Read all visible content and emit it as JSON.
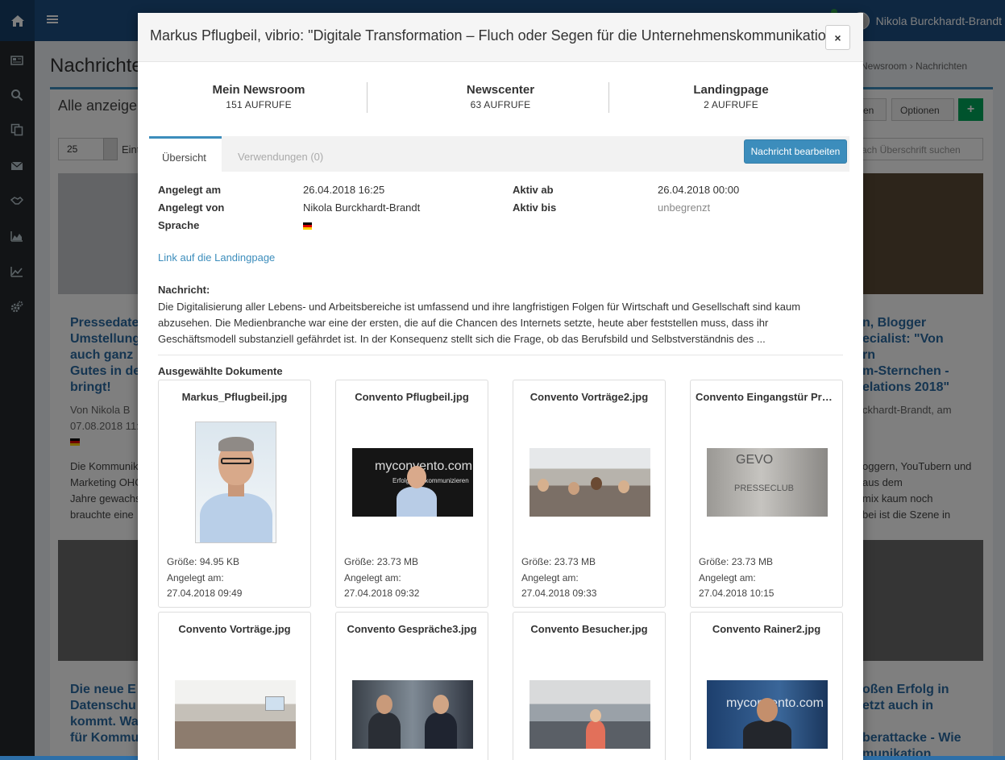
{
  "app": {
    "user_name": "Nikola Burckhardt-Brandt",
    "colors": {
      "topbar": "#1d4e82",
      "sidebar": "#24292d",
      "accent": "#3c8dbc",
      "success": "#00a65a"
    },
    "sidebar_icons": [
      "home-icon",
      "newspaper-icon",
      "search-icon",
      "copy-icon",
      "envelope-icon",
      "handshake-icon",
      "area-chart-icon",
      "line-chart-icon",
      "cogs-icon"
    ]
  },
  "background": {
    "page_title": "Nachrichten",
    "breadcrumb": {
      "newsroom": "Newsroom",
      "sep": "›",
      "current": "Nachrichten"
    },
    "panel_title": "Alle anzeigen",
    "page_size": "25",
    "page_size_suffix": "Eint",
    "buttons": {
      "partial": "en",
      "options": "Optionen"
    },
    "add_symbol": "+",
    "search_placeholder": "ach Überschrift suchen",
    "left_card": {
      "headline_lines": [
        "Pressedate",
        "Umstellung",
        "auch ganz",
        "Gutes in de",
        "bringt!"
      ],
      "meta_line1": "Von Nikola B",
      "meta_line2": "07.08.2018 11:",
      "text_lines": [
        "Die Kommunik",
        "Marketing OHC",
        "Jahre gewachs",
        "brauchte eine"
      ]
    },
    "right_card": {
      "headline_lines": [
        "n, Blogger",
        "ecialist: \"Von",
        "rn",
        "m-Sternchen -",
        "elations 2018\""
      ],
      "meta": "ckhardt-Brandt, am",
      "text_lines": [
        "oggern, YouTubern und",
        "aus dem",
        "mix kaum noch",
        "bei ist die Szene in"
      ]
    },
    "left_bottom": {
      "headline_lines": [
        "Die neue E",
        "Datenschu",
        "kommt. Wa",
        "für Kommu"
      ]
    },
    "right_bottom": {
      "headline_lines": [
        "oßen Erfolg in",
        "etzt auch in",
        "",
        "berattacke - Wie",
        "munikation"
      ]
    }
  },
  "modal": {
    "title": "Markus Pflugbeil, vibrio: \"Digitale Transformation – Fluch oder Segen für die Unternehmenskommunikation?\"",
    "close_label": "×",
    "stats": [
      {
        "label": "Mein Newsroom",
        "count": "151 AUFRUFE"
      },
      {
        "label": "Newscenter",
        "count": "63 AUFRUFE"
      },
      {
        "label": "Landingpage",
        "count": "2 AUFRUFE"
      }
    ],
    "tabs": [
      {
        "label": "Übersicht",
        "active": true
      },
      {
        "label": "Verwendungen (0)",
        "active": false
      }
    ],
    "edit_button": "Nachricht bearbeiten",
    "info": {
      "created_at_label": "Angelegt am",
      "created_at": "26.04.2018 16:25",
      "created_by_label": "Angelegt von",
      "created_by": "Nikola Burckhardt-Brandt",
      "language_label": "Sprache",
      "language_flag": "de-flag-icon",
      "active_from_label": "Aktiv ab",
      "active_from": "26.04.2018 00:00",
      "active_until_label": "Aktiv bis",
      "active_until": "unbegrenzt"
    },
    "landing_link": "Link auf die Landingpage",
    "message_label": "Nachricht:",
    "message_text": "Die Digitalisierung aller Lebens- und Arbeitsbereiche ist umfassend und ihre langfristigen Folgen für Wirtschaft und Gesellschaft sind kaum abzusehen. Die Medienbranche war eine der ersten, die auf die Chancen des Internets setzte, heute aber feststellen muss, dass ihr Geschäftsmodell substanziell gefährdet ist. In der Konsequenz stellt sich die Frage, ob das Berufsbild und Selbstverständnis des ...",
    "documents_label": "Ausgewählte Dokumente",
    "size_label": "Größe:",
    "created_label": "Angelegt am:",
    "documents": [
      {
        "name": "Markus_Pflugbeil.jpg",
        "size": "94.95 KB",
        "created": "27.04.2018 09:49",
        "thumb": "portrait"
      },
      {
        "name": "Convento Pflugbeil.jpg",
        "size": "23.73 MB",
        "created": "27.04.2018 09:32",
        "thumb": "mycom-dark"
      },
      {
        "name": "Convento Vorträge2.jpg",
        "size": "23.73 MB",
        "created": "27.04.2018 09:33",
        "thumb": "audience"
      },
      {
        "name": "Convento Eingangstür Presseclub.jpg",
        "size": "23.73 MB",
        "created": "27.04.2018 10:15",
        "thumb": "glass-door"
      },
      {
        "name": "Convento Vorträge.jpg",
        "thumb": "room"
      },
      {
        "name": "Convento Gespräche3.jpg",
        "thumb": "talk"
      },
      {
        "name": "Convento Besucher.jpg",
        "thumb": "crowd"
      },
      {
        "name": "Convento Rainer2.jpg",
        "thumb": "mycom-blue"
      }
    ],
    "thumb_texts": {
      "mycom": "myconvento.com",
      "mycom_sub": "Erfolgreich kommunizieren",
      "door_top": "GEVO",
      "door_bottom": "PRESSECLUB"
    }
  }
}
